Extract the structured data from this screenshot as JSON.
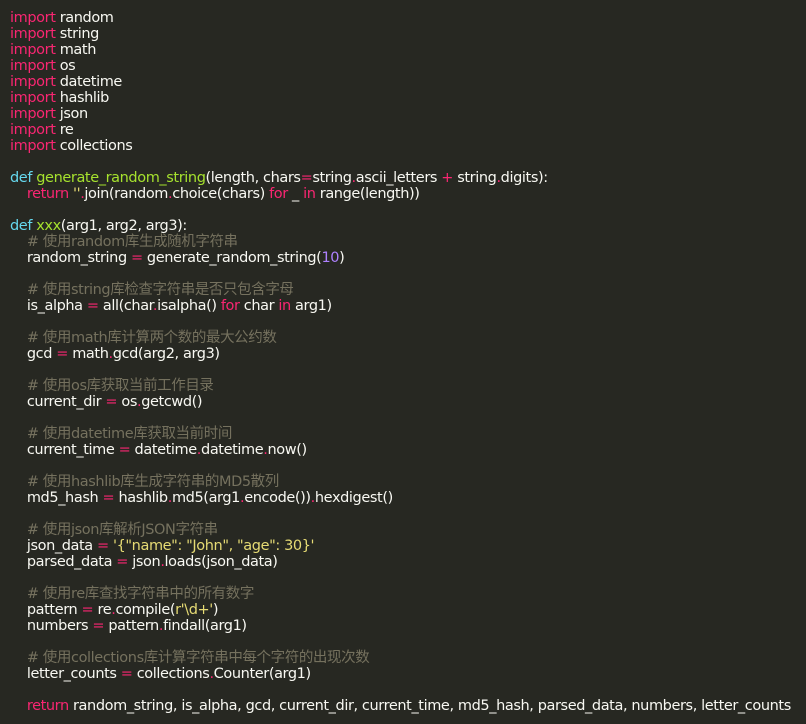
{
  "theme": {
    "background": "#272822",
    "keyword": "#f92672",
    "def": "#66d9ef",
    "function": "#a6e22e",
    "comment": "#75715e",
    "string": "#e6db74",
    "number": "#ae81ff",
    "text": "#f8f8f2"
  },
  "code": {
    "lines": [
      [
        [
          "keyword",
          "import"
        ],
        [
          "plain",
          " random"
        ]
      ],
      [
        [
          "keyword",
          "import"
        ],
        [
          "plain",
          " string"
        ]
      ],
      [
        [
          "keyword",
          "import"
        ],
        [
          "plain",
          " math"
        ]
      ],
      [
        [
          "keyword",
          "import"
        ],
        [
          "plain",
          " os"
        ]
      ],
      [
        [
          "keyword",
          "import"
        ],
        [
          "plain",
          " datetime"
        ]
      ],
      [
        [
          "keyword",
          "import"
        ],
        [
          "plain",
          " hashlib"
        ]
      ],
      [
        [
          "keyword",
          "import"
        ],
        [
          "plain",
          " json"
        ]
      ],
      [
        [
          "keyword",
          "import"
        ],
        [
          "plain",
          " re"
        ]
      ],
      [
        [
          "keyword",
          "import"
        ],
        [
          "plain",
          " collections"
        ]
      ],
      [],
      [
        [
          "def",
          "def"
        ],
        [
          "plain",
          " "
        ],
        [
          "fn",
          "generate_random_string"
        ],
        [
          "plain",
          "(length, chars"
        ],
        [
          "op",
          "="
        ],
        [
          "plain",
          "string"
        ],
        [
          "op",
          "."
        ],
        [
          "plain",
          "ascii_letters "
        ],
        [
          "op",
          "+"
        ],
        [
          "plain",
          " string"
        ],
        [
          "op",
          "."
        ],
        [
          "plain",
          "digits):"
        ]
      ],
      [
        [
          "plain",
          "    "
        ],
        [
          "keyword",
          "return"
        ],
        [
          "plain",
          " "
        ],
        [
          "string",
          "''"
        ],
        [
          "op",
          "."
        ],
        [
          "plain",
          "join(random"
        ],
        [
          "op",
          "."
        ],
        [
          "plain",
          "choice(chars) "
        ],
        [
          "keyword",
          "for"
        ],
        [
          "plain",
          " _ "
        ],
        [
          "keyword",
          "in"
        ],
        [
          "plain",
          " range(length))"
        ]
      ],
      [],
      [
        [
          "def",
          "def"
        ],
        [
          "plain",
          " "
        ],
        [
          "fn",
          "xxx"
        ],
        [
          "plain",
          "(arg1, arg2, arg3):"
        ]
      ],
      [
        [
          "plain",
          "    "
        ],
        [
          "comment",
          "# 使用random库生成随机字符串"
        ]
      ],
      [
        [
          "plain",
          "    random_string "
        ],
        [
          "op",
          "="
        ],
        [
          "plain",
          " generate_random_string("
        ],
        [
          "number",
          "10"
        ],
        [
          "plain",
          ")"
        ]
      ],
      [],
      [
        [
          "plain",
          "    "
        ],
        [
          "comment",
          "# 使用string库检查字符串是否只包含字母"
        ]
      ],
      [
        [
          "plain",
          "    is_alpha "
        ],
        [
          "op",
          "="
        ],
        [
          "plain",
          " all(char"
        ],
        [
          "op",
          "."
        ],
        [
          "plain",
          "isalpha() "
        ],
        [
          "keyword",
          "for"
        ],
        [
          "plain",
          " char "
        ],
        [
          "keyword",
          "in"
        ],
        [
          "plain",
          " arg1)"
        ]
      ],
      [],
      [
        [
          "plain",
          "    "
        ],
        [
          "comment",
          "# 使用math库计算两个数的最大公约数"
        ]
      ],
      [
        [
          "plain",
          "    gcd "
        ],
        [
          "op",
          "="
        ],
        [
          "plain",
          " math"
        ],
        [
          "op",
          "."
        ],
        [
          "plain",
          "gcd(arg2, arg3)"
        ]
      ],
      [],
      [
        [
          "plain",
          "    "
        ],
        [
          "comment",
          "# 使用os库获取当前工作目录"
        ]
      ],
      [
        [
          "plain",
          "    current_dir "
        ],
        [
          "op",
          "="
        ],
        [
          "plain",
          " os"
        ],
        [
          "op",
          "."
        ],
        [
          "plain",
          "getcwd()"
        ]
      ],
      [],
      [
        [
          "plain",
          "    "
        ],
        [
          "comment",
          "# 使用datetime库获取当前时间"
        ]
      ],
      [
        [
          "plain",
          "    current_time "
        ],
        [
          "op",
          "="
        ],
        [
          "plain",
          " datetime"
        ],
        [
          "op",
          "."
        ],
        [
          "plain",
          "datetime"
        ],
        [
          "op",
          "."
        ],
        [
          "plain",
          "now()"
        ]
      ],
      [],
      [
        [
          "plain",
          "    "
        ],
        [
          "comment",
          "# 使用hashlib库生成字符串的MD5散列"
        ]
      ],
      [
        [
          "plain",
          "    md5_hash "
        ],
        [
          "op",
          "="
        ],
        [
          "plain",
          " hashlib"
        ],
        [
          "op",
          "."
        ],
        [
          "plain",
          "md5(arg1"
        ],
        [
          "op",
          "."
        ],
        [
          "plain",
          "encode())"
        ],
        [
          "op",
          "."
        ],
        [
          "plain",
          "hexdigest()"
        ]
      ],
      [],
      [
        [
          "plain",
          "    "
        ],
        [
          "comment",
          "# 使用json库解析JSON字符串"
        ]
      ],
      [
        [
          "plain",
          "    json_data "
        ],
        [
          "op",
          "="
        ],
        [
          "plain",
          " "
        ],
        [
          "string",
          "'{\"name\": \"John\", \"age\": 30}'"
        ]
      ],
      [
        [
          "plain",
          "    parsed_data "
        ],
        [
          "op",
          "="
        ],
        [
          "plain",
          " json"
        ],
        [
          "op",
          "."
        ],
        [
          "plain",
          "loads(json_data)"
        ]
      ],
      [],
      [
        [
          "plain",
          "    "
        ],
        [
          "comment",
          "# 使用re库查找字符串中的所有数字"
        ]
      ],
      [
        [
          "plain",
          "    pattern "
        ],
        [
          "op",
          "="
        ],
        [
          "plain",
          " re"
        ],
        [
          "op",
          "."
        ],
        [
          "plain",
          "compile("
        ],
        [
          "string",
          "r'\\d+'"
        ],
        [
          "plain",
          ")"
        ]
      ],
      [
        [
          "plain",
          "    numbers "
        ],
        [
          "op",
          "="
        ],
        [
          "plain",
          " pattern"
        ],
        [
          "op",
          "."
        ],
        [
          "plain",
          "findall(arg1)"
        ]
      ],
      [],
      [
        [
          "plain",
          "    "
        ],
        [
          "comment",
          "# 使用collections库计算字符串中每个字符的出现次数"
        ]
      ],
      [
        [
          "plain",
          "    letter_counts "
        ],
        [
          "op",
          "="
        ],
        [
          "plain",
          " collections"
        ],
        [
          "op",
          "."
        ],
        [
          "plain",
          "Counter(arg1)"
        ]
      ],
      [],
      [
        [
          "plain",
          "    "
        ],
        [
          "keyword",
          "return"
        ],
        [
          "plain",
          " random_string, is_alpha, gcd, current_dir, current_time, md5_hash, parsed_data, numbers, letter_counts"
        ]
      ]
    ]
  }
}
